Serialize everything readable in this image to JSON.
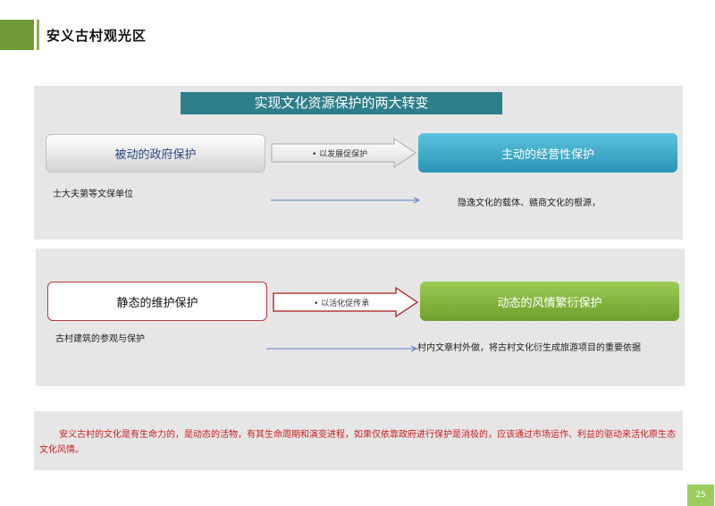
{
  "header": {
    "title": "安义古村观光区"
  },
  "section1": {
    "headline": "实现文化资源保护的两大转变",
    "left_box": "被动的政府保护",
    "arrow_label": "• 以发展促保护",
    "right_box": "主动的经营性保护",
    "left_note": "士大夫第等文保单位",
    "right_note": "隐逸文化的载体、赣商文化的根源，"
  },
  "section2": {
    "left_box": "静态的维护保护",
    "arrow_label": "• 以活化促传承",
    "right_box": "动态的风情繁衍保护",
    "left_note": "古村建筑的参观与保护",
    "right_note": "村内文章村外做，将古村文化衍生成旅游项目的重要依据"
  },
  "summary": {
    "text": "安义古村的文化是有生命力的，是动态的活物，有其生命周期和演变进程，如果仅依靠政府进行保护是消极的，应该通过市场运作、利益的驱动来活化原生态文化风情。"
  },
  "footer": {
    "page_number": "25"
  },
  "colors": {
    "accent_green": "#6f9a35",
    "headline_teal": "#2e7f8c",
    "active_blue": "#2b94b6",
    "dynamic_green": "#6e9e2c",
    "summary_red": "#cc1d1d"
  }
}
